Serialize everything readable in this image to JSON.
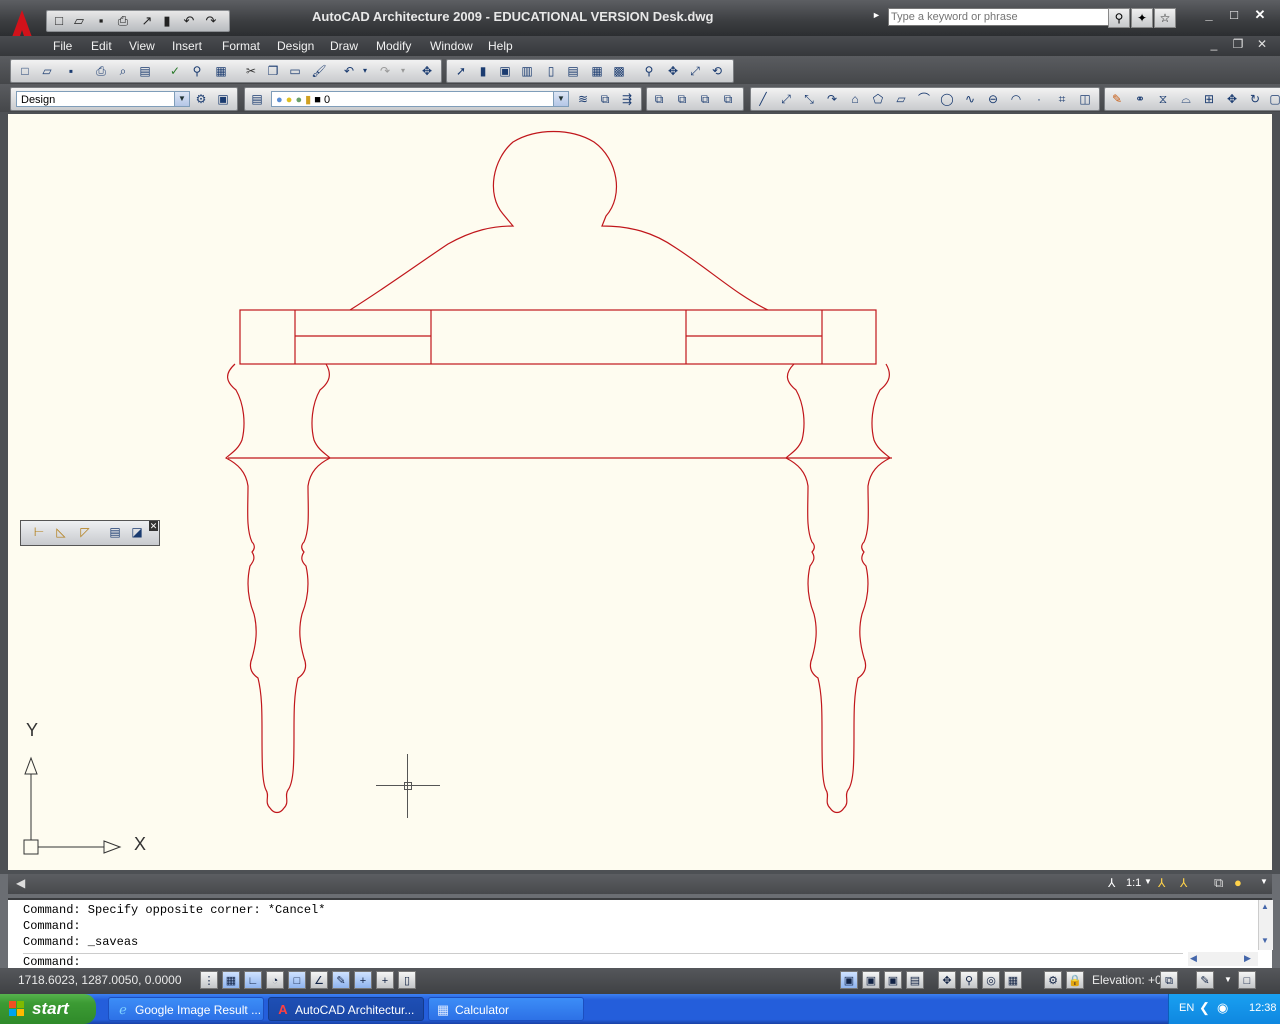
{
  "window": {
    "title": "AutoCAD Architecture 2009 - EDUCATIONAL VERSION Desk.dwg",
    "search_placeholder": "Type a keyword or phrase"
  },
  "menu": {
    "items": [
      "File",
      "Edit",
      "View",
      "Insert",
      "Format",
      "Design",
      "Draw",
      "Modify",
      "Window",
      "Help"
    ]
  },
  "toolbars": {
    "workspace_value": "Design",
    "layer_value": "0"
  },
  "drawing": {
    "line_color": "#c0161b",
    "background": "#fefcf0",
    "ucs_x_label": "X",
    "ucs_y_label": "Y"
  },
  "command": {
    "history": [
      "Command: Specify opposite corner: *Cancel*",
      "Command:",
      "Command: _saveas"
    ],
    "prompt": "Command:"
  },
  "status": {
    "coordinates": "1718.6023, 1287.0050, 0.0000",
    "annotation_scale": "1:1",
    "elevation": "Elevation: +0"
  },
  "taskbar": {
    "start_label": "start",
    "tasks": [
      {
        "label": "Google Image Result ...",
        "icon": "ie-icon"
      },
      {
        "label": "AutoCAD Architectur...",
        "icon": "autocad-icon"
      },
      {
        "label": "Calculator",
        "icon": "calculator-icon"
      }
    ],
    "language": "EN",
    "clock": "12:38"
  }
}
